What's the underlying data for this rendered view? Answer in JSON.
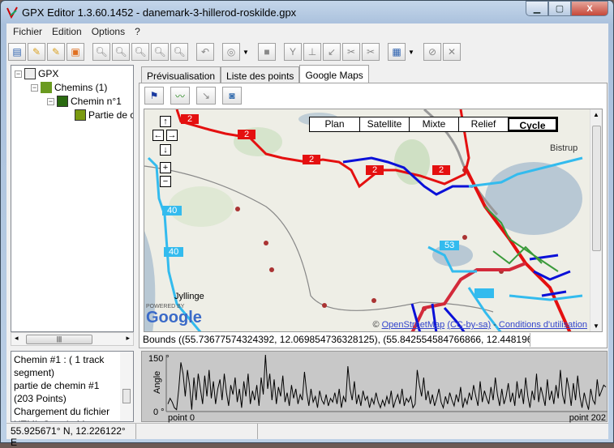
{
  "window": {
    "title": "GPX Editor 1.3.60.1452 - danemark-3-hillerod-roskilde.gpx",
    "controls": [
      "minimize",
      "maximize",
      "close"
    ]
  },
  "menu": [
    "Fichier",
    "Edition",
    "Options",
    "?"
  ],
  "toolbar": {
    "icons": [
      "new-icon",
      "edit-icon",
      "edit-points-icon",
      "export-icon",
      "zoom-icon",
      "zoom-in-icon",
      "zoom-out-icon",
      "zoom-fit-icon",
      "zoom-select-icon",
      "undo-icon",
      "gps-device-icon",
      "copy-icon",
      "filter-icon",
      "split-icon",
      "join-icon",
      "cut-icon",
      "cut-segment-icon",
      "save-map-icon",
      "link-icon",
      "delete-icon"
    ]
  },
  "tree": {
    "root": "GPX",
    "chemins": "Chemins (1)",
    "chemin": "Chemin n°1",
    "partie": "Partie de chemin"
  },
  "log": [
    "Chemin #1 :  ( 1 track segment)",
    "partie de chemin #1 (203 Points)",
    "Chargement du fichier HTML Google Map"
  ],
  "tabs": [
    {
      "label": "Prévisualisation"
    },
    {
      "label": "Liste des points"
    },
    {
      "label": "Google Maps",
      "active": true
    }
  ],
  "map": {
    "types": [
      {
        "label": "Plan"
      },
      {
        "label": "Satellite"
      },
      {
        "label": "Mixte"
      },
      {
        "label": "Relief"
      },
      {
        "label": "Cycle",
        "selected": true
      }
    ],
    "places": [
      "Bistrup",
      "Jyllinge"
    ],
    "route_labels": [
      "2",
      "2",
      "2",
      "2",
      "2",
      "40",
      "40",
      "53",
      "53"
    ],
    "nav": [
      "↑",
      "←",
      "→",
      "↓",
      "+",
      "−"
    ],
    "powered_by": "POWERED BY",
    "logo": "Google",
    "attribution": {
      "prefix": "© ",
      "osm": "OpenStreetMap",
      "cc": "(CC-by-sa)",
      "sep": " - ",
      "terms": "Conditions d'utilisation"
    }
  },
  "bounds": "Bounds ((55.73677574324392, 12.069854736328125), (55.842554584766866, 12.4481964111328",
  "chart_data": {
    "type": "line",
    "ylabel": "Angle",
    "ytick_labels": [
      "150 °",
      "0 °"
    ],
    "ylim": [
      0,
      150
    ],
    "xtick_labels": [
      "point 0",
      "point 202"
    ],
    "xlim": [
      0,
      202
    ],
    "line_color": "#000000",
    "background": "#c8c8c8",
    "values": [
      20,
      35,
      25,
      10,
      5,
      60,
      130,
      100,
      40,
      110,
      70,
      5,
      90,
      30,
      100,
      60,
      20,
      95,
      40,
      110,
      35,
      80,
      20,
      60,
      85,
      30,
      100,
      50,
      15,
      70,
      45,
      90,
      25,
      60,
      10,
      80,
      40,
      100,
      20,
      55,
      30,
      70,
      15,
      90,
      45,
      150,
      60,
      100,
      30,
      85,
      20,
      65,
      40,
      95,
      25,
      50,
      15,
      70,
      35,
      60,
      20,
      45,
      30,
      105,
      50,
      15,
      60,
      25,
      40,
      10,
      55,
      30,
      20,
      45,
      15,
      35,
      25,
      50,
      20,
      60,
      10,
      40,
      25,
      120,
      60,
      30,
      80,
      20,
      45,
      15,
      55,
      30,
      40,
      10,
      35,
      20,
      50,
      25,
      10,
      30,
      15,
      40,
      20,
      55,
      10,
      30,
      45,
      20,
      60,
      15,
      35,
      25,
      40,
      10,
      20,
      110,
      70,
      40,
      90,
      30,
      55,
      20,
      45,
      15,
      35,
      60,
      25,
      10,
      40,
      20,
      50,
      30,
      15,
      45,
      25,
      65,
      10,
      35,
      20,
      50,
      30,
      70,
      40,
      15,
      80,
      25,
      55,
      35,
      20,
      65,
      30,
      90,
      45,
      15,
      60,
      20,
      40,
      75,
      25,
      50,
      15,
      80,
      35,
      60,
      20,
      90,
      40,
      10,
      55,
      30,
      100,
      25,
      65,
      40,
      15,
      85,
      30,
      55,
      20,
      70,
      35,
      110,
      45,
      20,
      90,
      60,
      15,
      75,
      30,
      95,
      40,
      10,
      50,
      25,
      5,
      60,
      30,
      20,
      85,
      40,
      55,
      70,
      65
    ]
  },
  "status": {
    "coords": "55.925671° N, 12.226122° E"
  },
  "colors": {
    "route_red": "#e41010",
    "route_blue": "#0a10d8",
    "route_cyan": "#33bbee",
    "route_green": "#3a9a3a"
  }
}
